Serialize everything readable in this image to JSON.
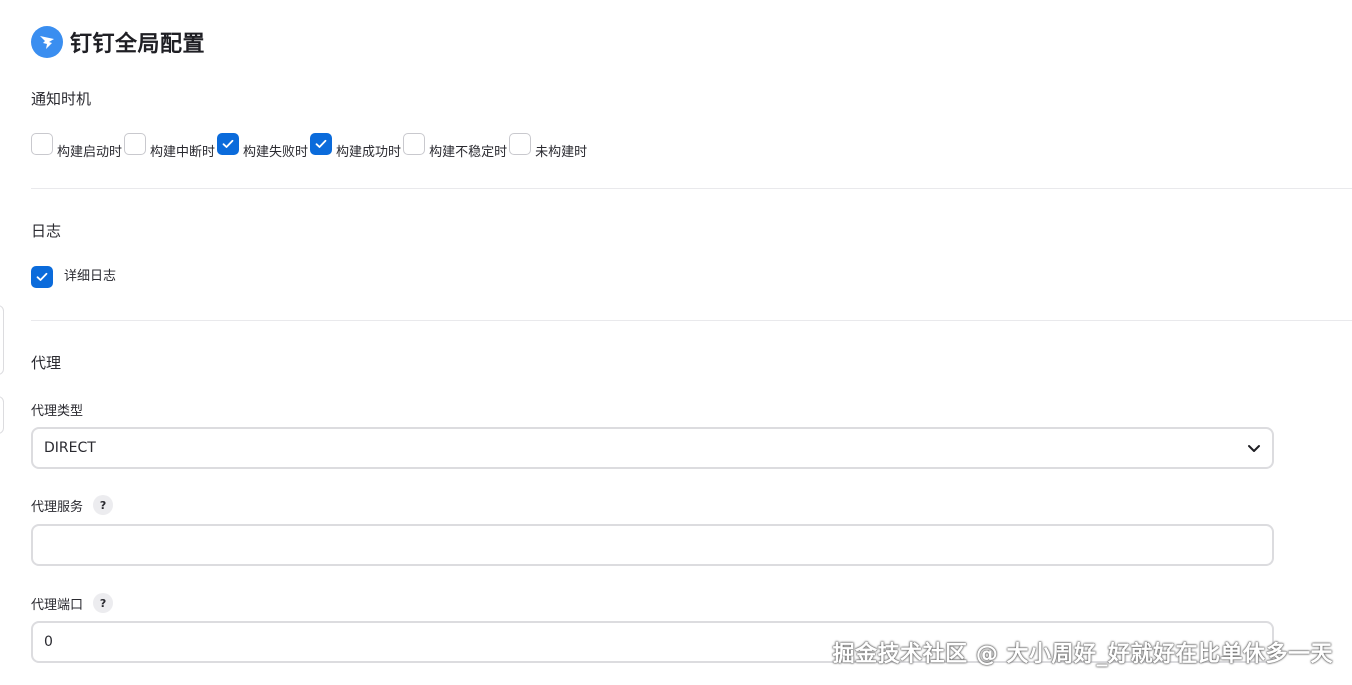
{
  "header": {
    "title": "钉钉全局配置",
    "logo_icon": "dingtalk-logo-icon",
    "logo_color": "#3a8ef0"
  },
  "notify": {
    "section_title": "通知时机",
    "options": [
      {
        "label": "构建启动时",
        "checked": false
      },
      {
        "label": "构建中断时",
        "checked": false
      },
      {
        "label": "构建失败时",
        "checked": true
      },
      {
        "label": "构建成功时",
        "checked": true
      },
      {
        "label": "构建不稳定时",
        "checked": false
      },
      {
        "label": "未构建时",
        "checked": false
      }
    ]
  },
  "log": {
    "section_title": "日志",
    "verbose_label": "详细日志",
    "verbose_checked": true
  },
  "proxy": {
    "section_title": "代理",
    "type_label": "代理类型",
    "type_value": "DIRECT",
    "server_label": "代理服务",
    "server_value": "",
    "port_label": "代理端口",
    "port_value": "0",
    "help_glyph": "?"
  },
  "watermark": "掘金技术社区 @ 大小周好_好就好在比单休多一天",
  "colors": {
    "accent": "#0b6bdb",
    "border": "#dcdcdf"
  }
}
